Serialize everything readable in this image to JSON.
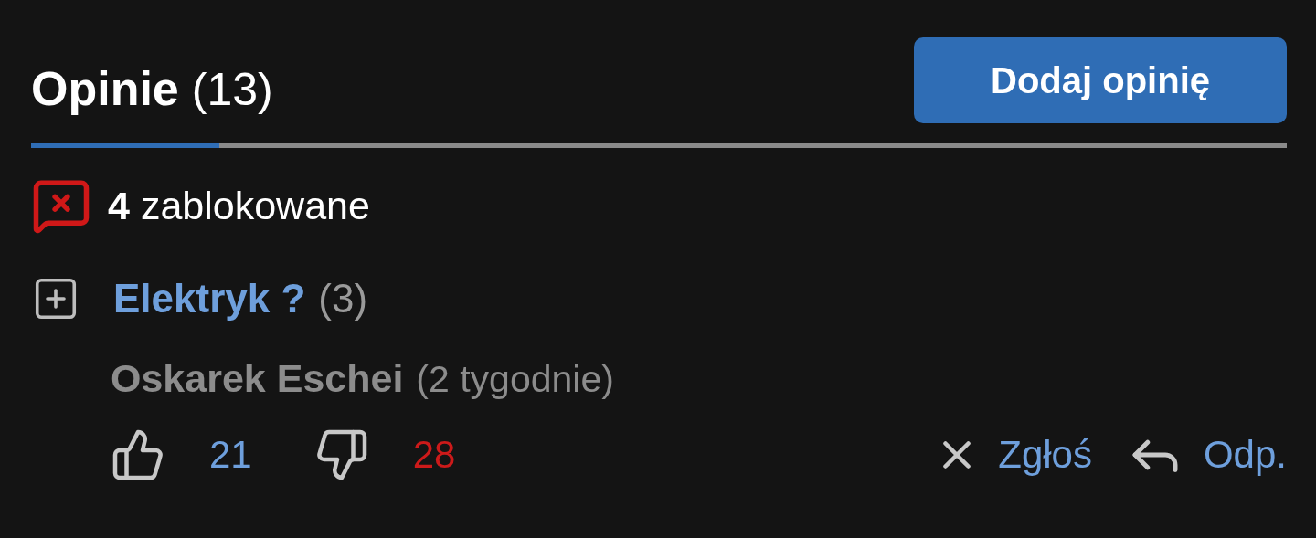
{
  "header": {
    "title": "Opinie",
    "count": "(13)",
    "add_button": "Dodaj opinię"
  },
  "blocked": {
    "count": "4",
    "label": "zablokowane"
  },
  "threads": [
    {
      "title": "Elektryk ?",
      "replies": "(3)",
      "expanded": false,
      "author": "Oskarek Eschei",
      "age": "(2 tygodnie)",
      "likes": "21",
      "dislikes": "28",
      "report": "Zgłoś",
      "reply": "Odp."
    }
  ]
}
